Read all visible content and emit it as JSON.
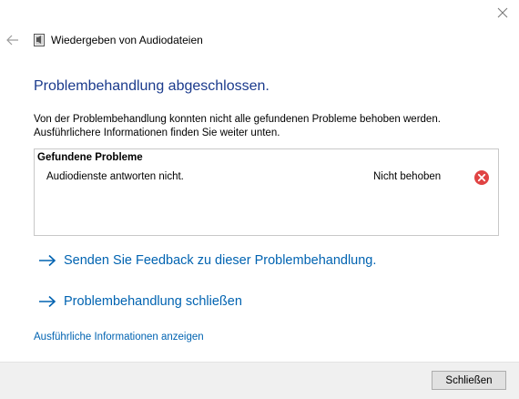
{
  "window": {
    "title": "Wiedergeben von Audiodateien"
  },
  "main": {
    "heading": "Problembehandlung abgeschlossen.",
    "description_line1": "Von der Problembehandlung konnten nicht alle gefundenen Probleme behoben werden.",
    "description_line2": "Ausführlichere Informationen finden Sie weiter unten."
  },
  "problems": {
    "header": "Gefundene Probleme",
    "items": [
      {
        "text": "Audiodienste antworten nicht.",
        "status": "Nicht behoben",
        "status_icon": "error-icon"
      }
    ]
  },
  "actions": {
    "feedback_label": "Senden Sie Feedback zu dieser Problembehandlung.",
    "close_troubleshooter_label": "Problembehandlung schließen"
  },
  "details_link": "Ausführliche Informationen anzeigen",
  "footer": {
    "close_button": "Schließen"
  },
  "colors": {
    "heading": "#1a3a8c",
    "link": "#0063b1",
    "error": "#e04343",
    "footer_bg": "#f0f0f0"
  },
  "icons": {
    "back": "back-arrow-icon",
    "close": "close-icon",
    "title": "audio-file-icon",
    "action_arrow": "arrow-right-icon",
    "status": "error-icon"
  }
}
